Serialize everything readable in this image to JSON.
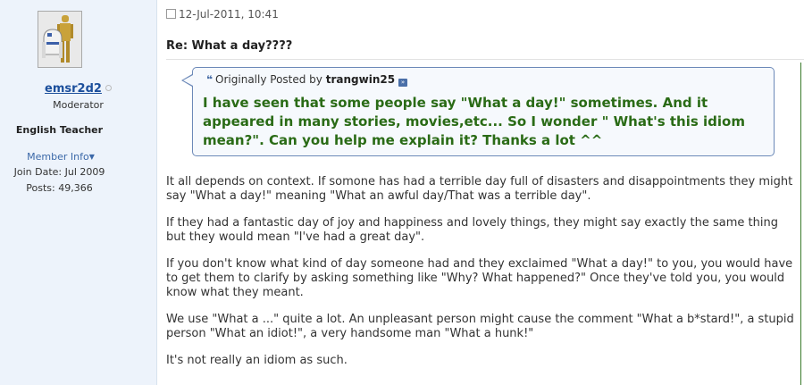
{
  "user": {
    "username": "emsr2d2",
    "rank": "Moderator",
    "title": "English Teacher",
    "member_info": "Member Info",
    "join_date": "Join Date: Jul 2009",
    "posts": "Posts: 49,366"
  },
  "post": {
    "date": "12-Jul-2011, 10:41",
    "title": "Re: What a day????",
    "quote": {
      "prefix": "Originally Posted by",
      "author": "trangwin25",
      "text": "I have seen that some people say \"What a day!\" sometimes. And it appeared in many stories, movies,etc... So I wonder \" What's this idiom mean?\". Can you help me explain it? Thanks a lot ^^"
    },
    "paragraphs": [
      "It all depends on context. If somone has had a terrible day full of disasters and disappointments they might say \"What a day!\" meaning \"What an awful day/That was a terrible day\".",
      "If they had a fantastic day of joy and happiness and lovely things, they might say exactly the same thing but they would mean \"I've had a great day\".",
      "If you don't know what kind of day someone had and they exclaimed \"What a day!\" to you, you would have to get them to clarify by asking something like \"Why? What happened?\" Once they've told you, you would know what they meant.",
      "We use \"What a ...\" quite a lot. An unpleasant person might cause the comment \"What a b*stard!\", a stupid person \"What an idiot!\", a very handsome man \"What a hunk!\"",
      "It's not really an idiom as such."
    ]
  },
  "colors": {
    "sidebar_bg": "#edf3fb",
    "username": "#1c4f9c",
    "quote_text": "#2a6b16",
    "quote_border": "#6c89b8"
  }
}
